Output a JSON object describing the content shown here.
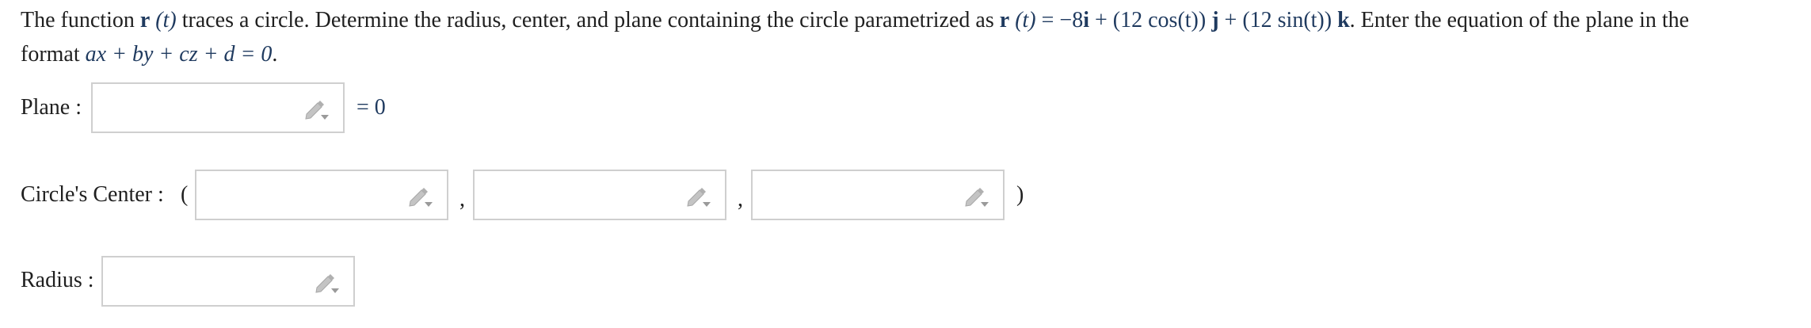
{
  "question": {
    "line1_a": "The function ",
    "r_bold": "r",
    "t_paren": "(t)",
    "line1_b": " traces a circle. Determine the radius, center, and plane containing the circle parametrized as ",
    "r_bold2": "r",
    "t_paren2": "(t)",
    "eq_expr_a": " = −8",
    "i_bold": "i",
    "eq_expr_b": " + (12 cos(t)) ",
    "j_bold": "j",
    "eq_expr_c": " + (12 sin(t)) ",
    "k_bold": "k",
    "line1_c": ". Enter the equation of the plane in the",
    "line2_a": "format ",
    "format_expr": "ax + by + cz + d = 0",
    "line2_b": "."
  },
  "plane": {
    "label": "Plane :",
    "suffix": "= 0",
    "value": ""
  },
  "center": {
    "label": "Circle's Center :",
    "open_paren": "(",
    "comma": ",",
    "close_paren": ")",
    "values": [
      "",
      "",
      ""
    ]
  },
  "radius": {
    "label": "Radius :",
    "value": ""
  },
  "icons": {
    "edit": "pencil-dropdown-icon"
  },
  "colors": {
    "math": "#1f3a5f",
    "box_border": "#cfcfcf",
    "icon": "#b8b8b8"
  }
}
